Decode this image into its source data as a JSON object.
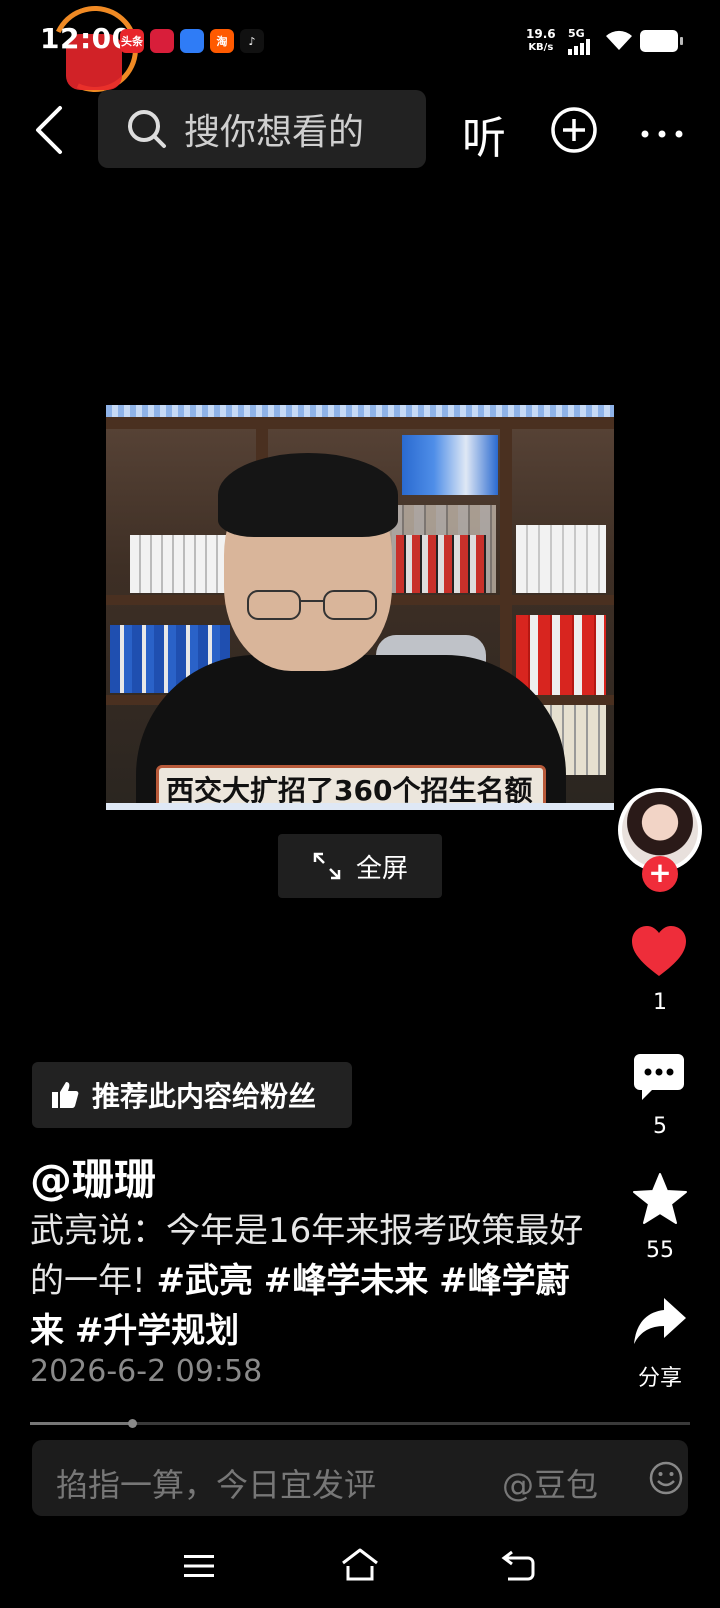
{
  "status_bar": {
    "time": "12:00",
    "net_speed_value": "19.6",
    "net_speed_unit": "KB/s",
    "network": "5G",
    "app_icons": [
      {
        "name": "toutiao-icon",
        "text": "头条",
        "color": "#e8262b"
      },
      {
        "name": "redbook-icon",
        "text": "",
        "color": "#d81e3a"
      },
      {
        "name": "browser-icon",
        "text": "",
        "color": "#2f7cf6"
      },
      {
        "name": "taobao-icon",
        "text": "淘",
        "color": "#ff5a00"
      },
      {
        "name": "tiktok-icon",
        "text": "♪",
        "color": "#111111"
      }
    ]
  },
  "top_bar": {
    "search_placeholder": "搜你想看的",
    "listen_label": "听"
  },
  "video": {
    "caption": "西交大扩招了360个招生名额",
    "fullscreen_label": "全屏"
  },
  "right_rail": {
    "like_count": "1",
    "comment_count": "5",
    "favorite_count": "55",
    "share_label": "分享"
  },
  "post": {
    "recommend_label": "推荐此内容给粉丝",
    "author": "@珊珊",
    "description": "武亮说：今年是16年来报考政策最好的一年!",
    "tags": [
      "#武亮",
      "#峰学未来",
      "#峰学蔚来",
      "#升学规划"
    ],
    "publish_time": "2026-6-2 09:58",
    "progress_fraction": 0.155
  },
  "comment_bar": {
    "placeholder": "掐指一算，今日宜发评",
    "mention": "@豆包"
  },
  "colors": {
    "accent_red": "#f02d3a",
    "like_red": "#ee2d3a"
  }
}
